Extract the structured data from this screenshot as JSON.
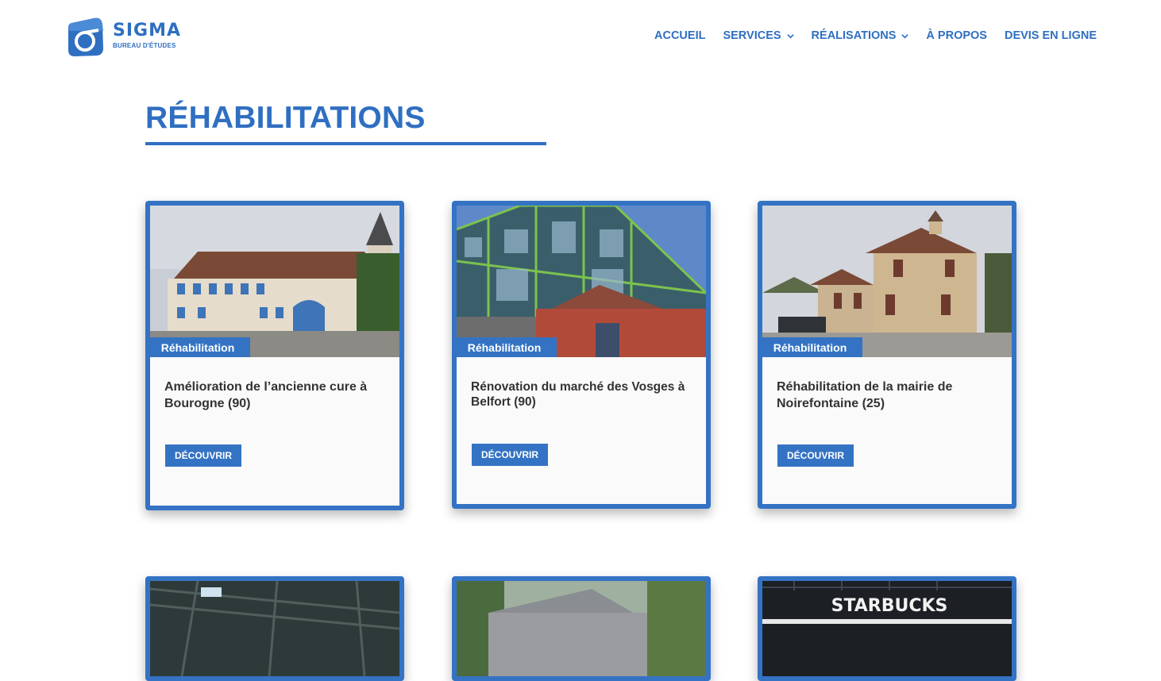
{
  "brand": {
    "name": "SIGMA",
    "tagline": "BUREAU D'ÉTUDES",
    "color": "#2f6fc1"
  },
  "nav": [
    {
      "label": "ACCUEIL",
      "dropdown": false
    },
    {
      "label": "SERVICES",
      "dropdown": true
    },
    {
      "label": "RÉALISATIONS",
      "dropdown": true
    },
    {
      "label": "À PROPOS",
      "dropdown": false
    },
    {
      "label": "DEVIS EN LIGNE",
      "dropdown": false
    }
  ],
  "page": {
    "title": "RÉHABILITATIONS"
  },
  "cards": [
    {
      "badge": "Réhabilitation",
      "title": "Amélioration de l’ancienne cure à Bourogne (90)",
      "button": "DÉCOUVRIR"
    },
    {
      "badge": "Réhabilitation",
      "title": "Rénovation du marché des Vosges à Belfort (90)",
      "button": "DÉCOUVRIR"
    },
    {
      "badge": "Réhabilitation",
      "title": "Réhabilitation de la mairie de Noirefontaine (25)",
      "button": "DÉCOUVRIR"
    }
  ],
  "row2_images": {
    "starbucks_sign": "STARBUCKS"
  }
}
